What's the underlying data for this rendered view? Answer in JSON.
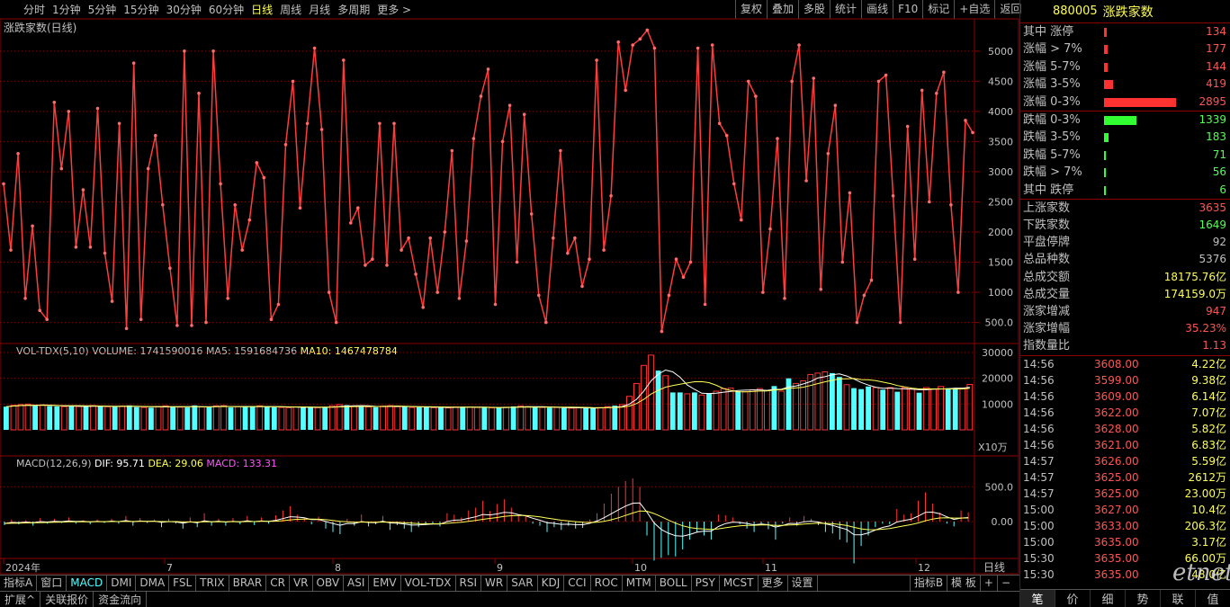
{
  "top_tabs": [
    "分时",
    "1分钟",
    "5分钟",
    "15分钟",
    "30分钟",
    "60分钟",
    "日线",
    "周线",
    "月线",
    "多周期",
    "更多 >"
  ],
  "active_tab": "日线",
  "right_buttons": [
    "复权",
    "叠加",
    "多股",
    "统计",
    "画线",
    "F10",
    "标记",
    "+自选",
    "返回"
  ],
  "panels": {
    "main_title": "涨跌家数(日线)",
    "vol_label": "VOL-TDX(5,10)",
    "vol_values": {
      "volume": "VOLUME: 1741590016",
      "ma5": "MA5: 1591684736",
      "ma10": "MA10: 1467478784"
    },
    "vol_unit": "X10万",
    "macd_label": "MACD(12,26,9)",
    "macd_values": {
      "dif": "DIF: 95.71",
      "dea": "DEA: 29.06",
      "macd": "MACD: 133.31"
    },
    "period_label": "日线",
    "date_labels": [
      "2024年",
      "7",
      "8",
      "9",
      "10",
      "11",
      "12"
    ]
  },
  "chart_data": [
    {
      "type": "line",
      "name": "涨跌家数",
      "ylim": [
        300,
        5400
      ],
      "yticks": [
        "5000",
        "4500",
        "4000",
        "3500",
        "3000",
        "2500",
        "2000",
        "1500",
        "1000",
        "500.0"
      ],
      "values": [
        2800,
        1700,
        3300,
        900,
        2100,
        700,
        550,
        4150,
        3050,
        4000,
        1750,
        2700,
        1750,
        4050,
        1650,
        850,
        3800,
        400,
        4800,
        550,
        3050,
        3600,
        2450,
        1400,
        450,
        5000,
        450,
        4300,
        500,
        5000,
        2800,
        900,
        2450,
        1700,
        2200,
        3150,
        2900,
        550,
        800,
        3450,
        4500,
        2400,
        3800,
        5050,
        3700,
        1000,
        500,
        4850,
        2150,
        2400,
        1450,
        1550,
        3800,
        1450,
        3800,
        1700,
        1900,
        1300,
        750,
        1900,
        1000,
        2000,
        3350,
        900,
        1850,
        3550,
        4250,
        4700,
        800,
        3500,
        4100,
        1500,
        3950,
        2300,
        950,
        500,
        1900,
        3350,
        1650,
        1900,
        1100,
        1550,
        4850,
        1700,
        2600,
        5150,
        4350,
        5100,
        5200,
        5350,
        5050,
        350,
        950,
        1550,
        1250,
        1500,
        5050,
        800,
        5100,
        3800,
        3600,
        2800,
        2200,
        4500,
        4250,
        1000,
        2050,
        3550,
        900,
        4500,
        5100,
        2850,
        4550,
        1050,
        3300,
        4100,
        1500,
        2650,
        500,
        950,
        1200,
        4500,
        4600,
        2600,
        500,
        3750,
        1550,
        4350,
        2500,
        4300,
        4650,
        2450,
        1000,
        3850,
        3650
      ]
    },
    {
      "type": "bar",
      "name": "VOL-TDX",
      "ylim": [
        0,
        30000
      ],
      "yticks": [
        "30000",
        "20000",
        "10000"
      ],
      "unit": "X10万",
      "values": [
        9000,
        9500,
        9800,
        10000,
        9400,
        9600,
        9200,
        9100,
        9000,
        9300,
        9100,
        8900,
        9400,
        9300,
        9000,
        8900,
        9200,
        9500,
        8800,
        8700,
        8600,
        9000,
        9300,
        9100,
        8800,
        8700,
        9500,
        8900,
        8800,
        9300,
        9400,
        8700,
        9000,
        8900,
        9100,
        9300,
        8900,
        8800,
        8700,
        8600,
        8900,
        8800,
        8700,
        8600,
        8700,
        9400,
        9800,
        9600,
        9200,
        9000,
        8900,
        8800,
        9200,
        9400,
        9000,
        8900,
        8700,
        8800,
        8900,
        8600,
        8700,
        8500,
        8900,
        9000,
        8800,
        8700,
        8600,
        8500,
        8700,
        8800,
        9100,
        9300,
        9000,
        8800,
        8700,
        8600,
        8700,
        8500,
        8400,
        8600,
        8500,
        8400,
        8600,
        9000,
        9400,
        9800,
        13000,
        18000,
        25000,
        29000,
        23000,
        21000,
        14500,
        14500,
        14000,
        14500,
        13500,
        14000,
        15000,
        16000,
        16200,
        15000,
        14800,
        15500,
        16000,
        15200,
        17000,
        15000,
        20000,
        18000,
        19000,
        21500,
        22000,
        22500,
        22000,
        20500,
        17500,
        16200,
        15800,
        16800,
        16400,
        15600,
        16400,
        14800,
        16400,
        15800,
        14400,
        16400,
        15800,
        16800,
        16200,
        15800,
        16200,
        17600
      ],
      "up": [
        0,
        1,
        1,
        1,
        0,
        1,
        0,
        0,
        1,
        0,
        1,
        0,
        1,
        0,
        1,
        0,
        1,
        0,
        0,
        1,
        0,
        1,
        1,
        0,
        1,
        0,
        0,
        1,
        0,
        1,
        1,
        0,
        1,
        0,
        0,
        1,
        0,
        0,
        1,
        1,
        1,
        0,
        0,
        1,
        0,
        1,
        1,
        0,
        1,
        0,
        1,
        0,
        1,
        1,
        1,
        0,
        1,
        0,
        0,
        1,
        0,
        1,
        1,
        0,
        1,
        1,
        0,
        1,
        0,
        1,
        0,
        1,
        1,
        0,
        1,
        0,
        1,
        0,
        1,
        1,
        0,
        0,
        1,
        1,
        0,
        1,
        1,
        1,
        1,
        1,
        0,
        1,
        0,
        0,
        1,
        0,
        1,
        0,
        1,
        1,
        1,
        0,
        1,
        1,
        1,
        1,
        0,
        1,
        0,
        1,
        1,
        1,
        1,
        1,
        0,
        0,
        1,
        0,
        0,
        0,
        1,
        0,
        1,
        0,
        1,
        1,
        0,
        1,
        1,
        1,
        0,
        0,
        1,
        1
      ]
    },
    {
      "type": "bar",
      "name": "MACD",
      "ylim": [
        -800,
        800
      ],
      "yticks": [
        "500.0",
        "0.00"
      ],
      "values": [
        -50,
        30,
        -40,
        20,
        -60,
        50,
        -30,
        40,
        -20,
        60,
        -30,
        20,
        -40,
        30,
        -20,
        40,
        -30,
        80,
        -60,
        50,
        -20,
        30,
        -80,
        40,
        -30,
        -100,
        60,
        -80,
        120,
        -60,
        40,
        -60,
        50,
        -40,
        80,
        -50,
        60,
        -30,
        90,
        160,
        220,
        100,
        60,
        -40,
        70,
        -100,
        -150,
        -180,
        40,
        -60,
        100,
        -70,
        -40,
        80,
        -120,
        -50,
        -100,
        -150,
        -80,
        -50,
        -40,
        -70,
        120,
        100,
        60,
        160,
        200,
        300,
        150,
        250,
        320,
        200,
        100,
        90,
        -30,
        -60,
        -150,
        -80,
        -120,
        -60,
        -100,
        -90,
        30,
        120,
        260,
        400,
        500,
        580,
        620,
        500,
        -200,
        -560,
        -520,
        -480,
        -500,
        -400,
        -260,
        -160,
        -200,
        -260,
        100,
        90,
        60,
        -40,
        -100,
        -150,
        -30,
        -110,
        -260,
        -30,
        60,
        -60,
        80,
        40,
        -50,
        -150,
        -170,
        -260,
        -300,
        -600,
        -350,
        -200,
        -80,
        -30,
        -40,
        180,
        100,
        120,
        300,
        420,
        260,
        130,
        -30,
        -70,
        160,
        133
      ]
    }
  ],
  "sidebar": {
    "code": "880005",
    "name": "涨跌家数",
    "breakdown": [
      {
        "label": "其中 涨停",
        "value": "134",
        "frac": 0.04,
        "up": true
      },
      {
        "label": "涨幅 > 7%",
        "value": "177",
        "frac": 0.05,
        "up": true
      },
      {
        "label": "涨幅 5-7%",
        "value": "144",
        "frac": 0.045,
        "up": true
      },
      {
        "label": "涨幅 3-5%",
        "value": "419",
        "frac": 0.13,
        "up": true
      },
      {
        "label": "涨幅 0-3%",
        "value": "2895",
        "frac": 1.0,
        "up": true
      },
      {
        "label": "跌幅 0-3%",
        "value": "1339",
        "frac": 0.45,
        "up": false
      },
      {
        "label": "跌幅 3-5%",
        "value": "183",
        "frac": 0.06,
        "up": false
      },
      {
        "label": "跌幅 5-7%",
        "value": "71",
        "frac": 0.02,
        "up": false
      },
      {
        "label": "跌幅 > 7%",
        "value": "56",
        "frac": 0.018,
        "up": false
      },
      {
        "label": "其中 跌停",
        "value": "6",
        "frac": 0.01,
        "up": false
      }
    ],
    "stats": [
      {
        "label": "上涨家数",
        "value": "3635",
        "color": "#ff5555"
      },
      {
        "label": "下跌家数",
        "value": "1649",
        "color": "#54ff54"
      },
      {
        "label": "平盘停牌",
        "value": "92",
        "color": "#c0c0c0"
      },
      {
        "label": "总品种数",
        "value": "5376",
        "color": "#c0c0c0"
      },
      {
        "label": "总成交额",
        "value": "18175.76亿",
        "color": "#ffff54"
      },
      {
        "label": "总成交量",
        "value": "174159.0万",
        "color": "#ffff54"
      },
      {
        "label": "涨家增减",
        "value": "947",
        "color": "#ff5555"
      },
      {
        "label": "涨家增幅",
        "value": "35.23%",
        "color": "#ff5555"
      },
      {
        "label": "指数量比",
        "value": "1.13",
        "color": "#ff5555"
      }
    ],
    "ticks": [
      {
        "time": "14:56",
        "price": "3608.00",
        "vol": "4.22亿"
      },
      {
        "time": "14:56",
        "price": "3599.00",
        "vol": "9.38亿"
      },
      {
        "time": "14:56",
        "price": "3609.00",
        "vol": "6.14亿"
      },
      {
        "time": "14:56",
        "price": "3622.00",
        "vol": "7.07亿"
      },
      {
        "time": "14:56",
        "price": "3628.00",
        "vol": "5.82亿"
      },
      {
        "time": "14:56",
        "price": "3621.00",
        "vol": "6.83亿"
      },
      {
        "time": "14:57",
        "price": "3626.00",
        "vol": "5.59亿"
      },
      {
        "time": "14:57",
        "price": "3625.00",
        "vol": "2612万"
      },
      {
        "time": "14:57",
        "price": "3625.00",
        "vol": "23.00万"
      },
      {
        "time": "15:00",
        "price": "3627.00",
        "vol": "10.4亿"
      },
      {
        "time": "15:00",
        "price": "3633.00",
        "vol": "206.3亿"
      },
      {
        "time": "15:00",
        "price": "3635.00",
        "vol": "3.17亿"
      },
      {
        "time": "15:30",
        "price": "3635.00",
        "vol": "66.00万"
      },
      {
        "time": "15:30",
        "price": "3635.00",
        "vol": "48.0亿"
      }
    ],
    "tabs": [
      "笔",
      "价",
      "细",
      "势",
      "联",
      "值"
    ]
  },
  "indicator_tabs": [
    "指标A",
    "窗口",
    "MACD",
    "DMI",
    "DMA",
    "FSL",
    "TRIX",
    "BRAR",
    "CR",
    "VR",
    "OBV",
    "ASI",
    "EMV",
    "VOL-TDX",
    "RSI",
    "WR",
    "SAR",
    "KDJ",
    "CCI",
    "ROC",
    "MTM",
    "BOLL",
    "PSY",
    "MCST",
    "更多",
    "设置"
  ],
  "active_indicator": "MACD",
  "indicator_right": [
    "指标B",
    "模 板",
    "+",
    "−"
  ],
  "bottom_tabs": [
    "扩展^",
    "关联报价",
    "资金流向"
  ],
  "watermark": "etnet",
  "colors": {
    "up": "#ff3232",
    "down": "#54ffff",
    "grid": "#8b0000",
    "dif": "#ffffff",
    "dea": "#ffff54",
    "macd": "#ff54ff"
  }
}
